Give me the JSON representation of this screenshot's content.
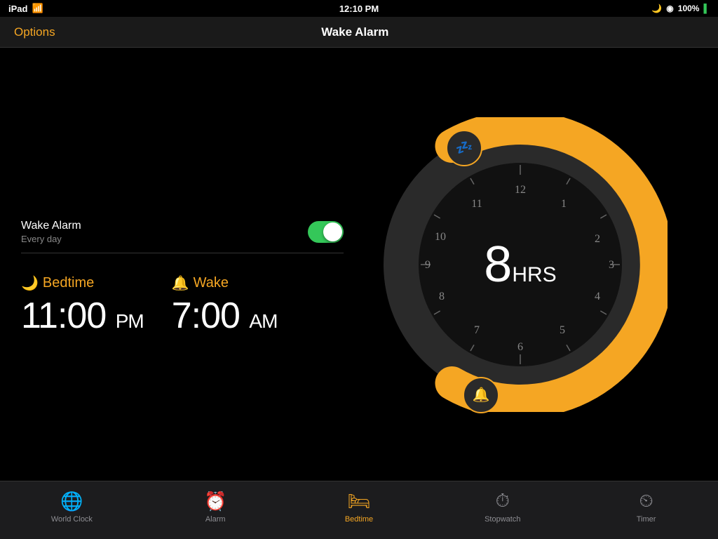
{
  "statusBar": {
    "device": "iPad",
    "wifi": "WiFi",
    "time": "12:10 PM",
    "battery": "100%"
  },
  "navBar": {
    "title": "Wake Alarm",
    "optionsLabel": "Options"
  },
  "alarmSection": {
    "label": "Wake Alarm",
    "sublabel": "Every day",
    "toggleOn": true
  },
  "bedtime": {
    "icon": "🌙",
    "label": "Bedtime",
    "time": "11:00",
    "ampm": "PM"
  },
  "wake": {
    "icon": "🔔",
    "label": "Wake",
    "time": "7:00",
    "ampm": "AM"
  },
  "clock": {
    "hoursValue": "8",
    "hoursLabel": "HRS",
    "numbers": [
      "1",
      "2",
      "3",
      "4",
      "5",
      "6",
      "7",
      "8",
      "9",
      "10",
      "11",
      "12"
    ]
  },
  "tabs": [
    {
      "id": "world-clock",
      "label": "World Clock",
      "icon": "🌐",
      "active": false
    },
    {
      "id": "alarm",
      "label": "Alarm",
      "icon": "⏰",
      "active": false
    },
    {
      "id": "bedtime",
      "label": "Bedtime",
      "icon": "🛏",
      "active": true
    },
    {
      "id": "stopwatch",
      "label": "Stopwatch",
      "icon": "⏱",
      "active": false
    },
    {
      "id": "timer",
      "label": "Timer",
      "icon": "⏲",
      "active": false
    }
  ],
  "handles": {
    "sleep": "💤",
    "wake": "🔔"
  }
}
